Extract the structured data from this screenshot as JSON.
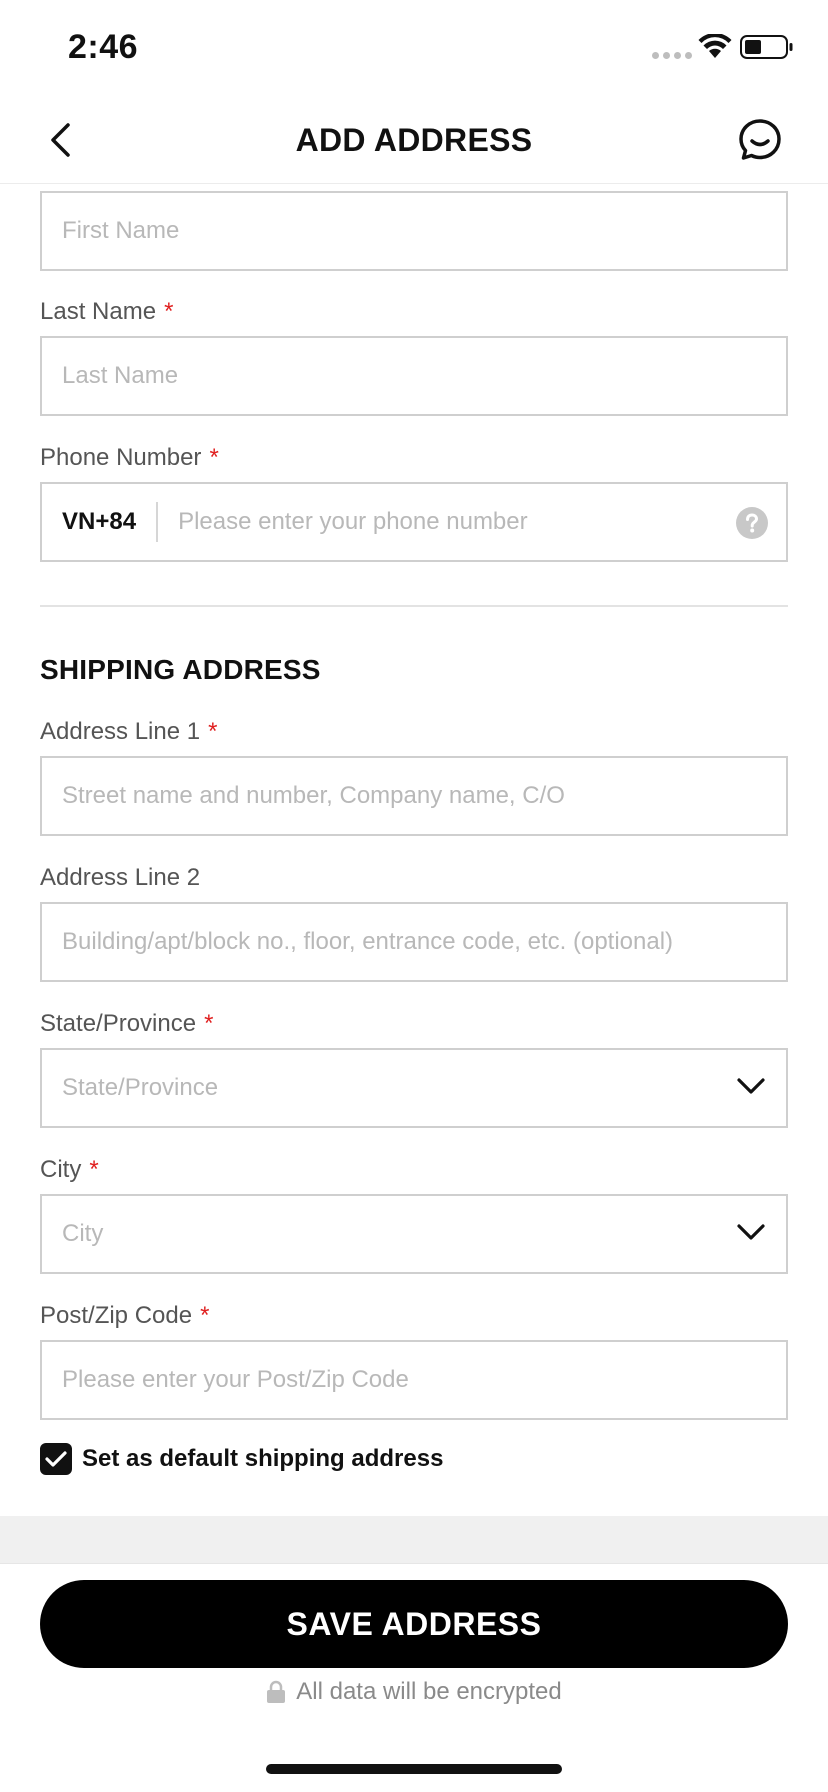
{
  "status_bar": {
    "time": "2:46"
  },
  "nav": {
    "title": "ADD ADDRESS"
  },
  "contact": {
    "first_name": {
      "placeholder": "First Name"
    },
    "last_name": {
      "label": "Last Name",
      "required_mark": "*",
      "placeholder": "Last Name"
    },
    "phone": {
      "label": "Phone Number",
      "required_mark": "*",
      "country_code": "VN+84",
      "placeholder": "Please enter your phone number"
    }
  },
  "shipping": {
    "section_title": "SHIPPING ADDRESS",
    "address_line_1": {
      "label": "Address Line 1",
      "required_mark": "*",
      "placeholder": "Street name and number, Company name, C/O"
    },
    "address_line_2": {
      "label": "Address Line 2",
      "placeholder": "Building/apt/block no., floor, entrance code, etc. (optional)"
    },
    "state": {
      "label": "State/Province",
      "required_mark": "*",
      "placeholder": "State/Province"
    },
    "city": {
      "label": "City",
      "required_mark": "*",
      "placeholder": "City"
    },
    "zip": {
      "label": "Post/Zip Code",
      "required_mark": "*",
      "placeholder": "Please enter your Post/Zip Code"
    },
    "default_checkbox": {
      "label": "Set as default shipping address",
      "checked": true
    }
  },
  "footer": {
    "save_label": "SAVE ADDRESS",
    "encrypt_note": "All data will be encrypted"
  },
  "colors": {
    "required": "#e02020",
    "primary": "#000000",
    "placeholder": "#b8b8b8"
  },
  "icons": [
    "back-chevron-icon",
    "chat-bubble-icon",
    "help-icon",
    "chevron-down-icon",
    "check-icon",
    "lock-icon",
    "wifi-icon",
    "battery-icon"
  ]
}
